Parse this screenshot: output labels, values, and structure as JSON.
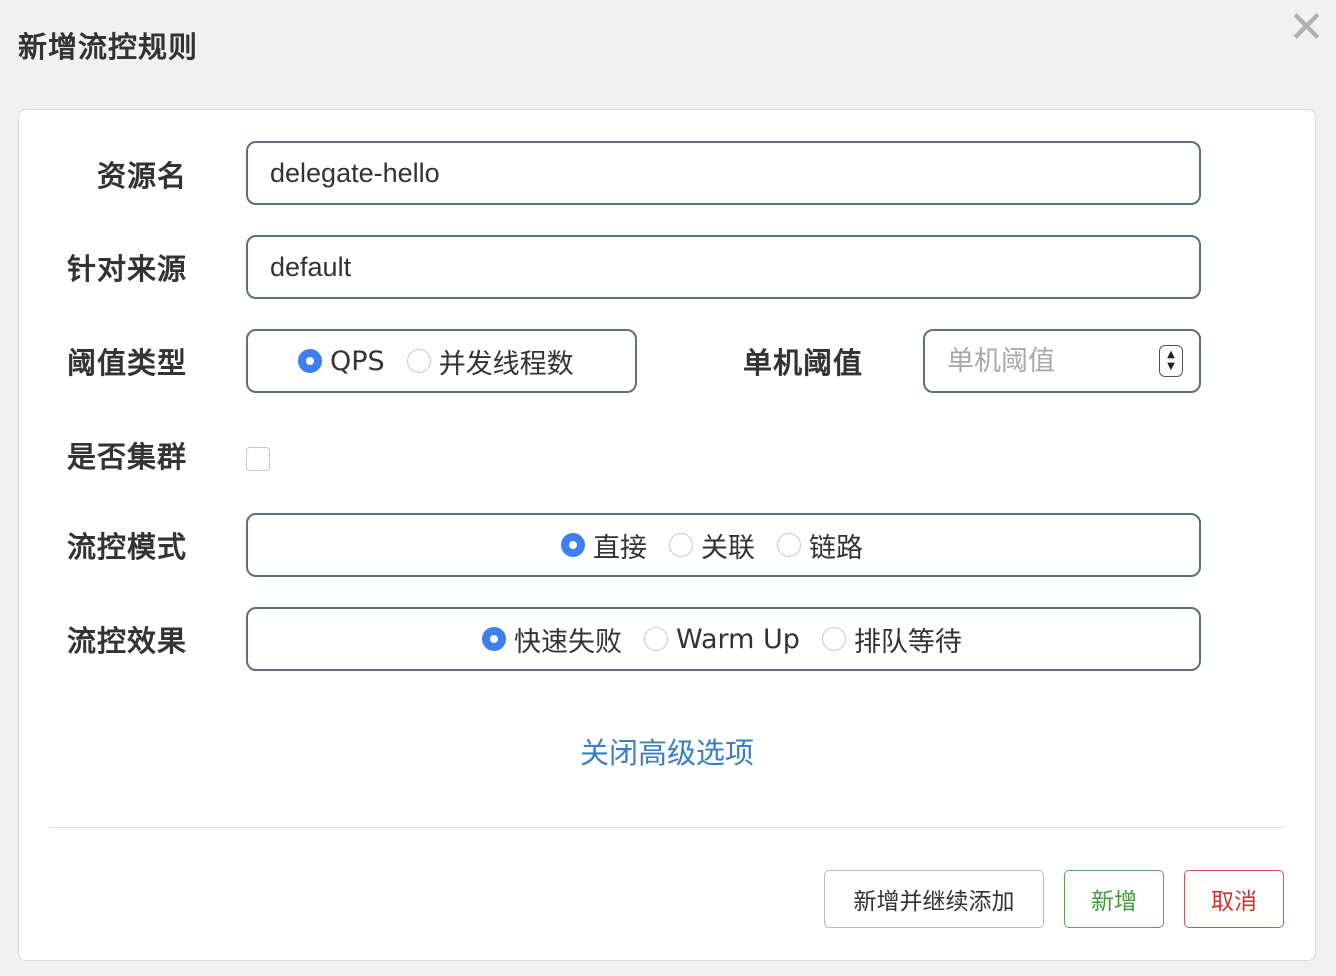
{
  "dialog": {
    "title": "新增流控规则",
    "close_symbol": "✕"
  },
  "form": {
    "resource": {
      "label": "资源名",
      "value": "delegate-hello"
    },
    "origin": {
      "label": "针对来源",
      "value": "default"
    },
    "threshold_type": {
      "label": "阈值类型",
      "options": [
        "QPS",
        "并发线程数"
      ],
      "selected": "QPS"
    },
    "threshold": {
      "label": "单机阈值",
      "placeholder": "单机阈值",
      "value": ""
    },
    "cluster": {
      "label": "是否集群",
      "checked": false
    },
    "control_mode": {
      "label": "流控模式",
      "options": [
        "直接",
        "关联",
        "链路"
      ],
      "selected": "直接"
    },
    "control_effect": {
      "label": "流控效果",
      "options": [
        "快速失败",
        "Warm Up",
        "排队等待"
      ],
      "selected": "快速失败"
    },
    "advanced_toggle": "关闭高级选项"
  },
  "footer": {
    "add_continue_label": "新增并继续添加",
    "add_label": "新增",
    "cancel_label": "取消"
  },
  "colors": {
    "accent": "#3b7ff1",
    "link": "#3a7fc2",
    "success": "#55a852",
    "danger": "#d9534f"
  }
}
